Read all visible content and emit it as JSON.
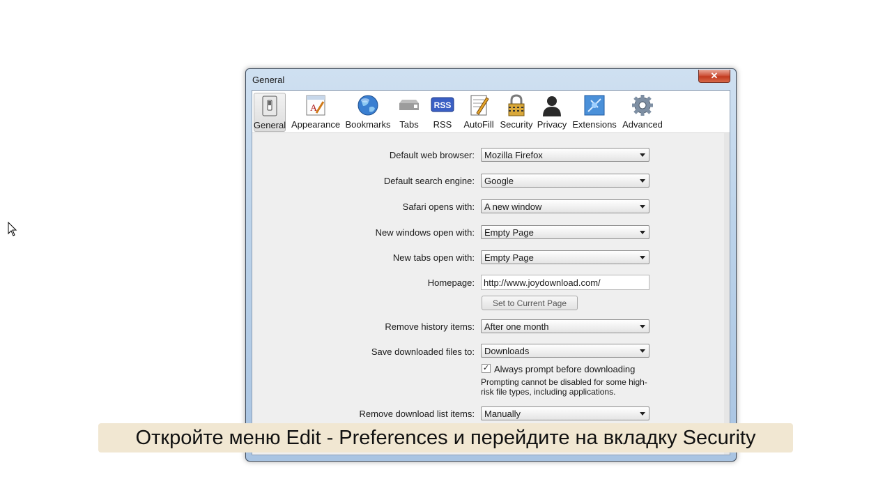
{
  "window": {
    "title": "General",
    "close_glyph": "✕"
  },
  "toolbar": {
    "items": [
      {
        "label": "General",
        "icon": "general-switch-icon",
        "active": true
      },
      {
        "label": "Appearance",
        "icon": "appearance-icon"
      },
      {
        "label": "Bookmarks",
        "icon": "globe-icon"
      },
      {
        "label": "Tabs",
        "icon": "tabs-icon"
      },
      {
        "label": "RSS",
        "icon": "rss-icon"
      },
      {
        "label": "AutoFill",
        "icon": "autofill-icon"
      },
      {
        "label": "Security",
        "icon": "lock-icon"
      },
      {
        "label": "Privacy",
        "icon": "person-silhouette-icon"
      },
      {
        "label": "Extensions",
        "icon": "extensions-icon"
      },
      {
        "label": "Advanced",
        "icon": "gear-icon"
      }
    ]
  },
  "form": {
    "default_browser": {
      "label": "Default web browser:",
      "value": "Mozilla Firefox"
    },
    "search_engine": {
      "label": "Default search engine:",
      "value": "Google"
    },
    "safari_opens": {
      "label": "Safari opens with:",
      "value": "A new window"
    },
    "new_windows": {
      "label": "New windows open with:",
      "value": "Empty Page"
    },
    "new_tabs": {
      "label": "New tabs open with:",
      "value": "Empty Page"
    },
    "homepage": {
      "label": "Homepage:",
      "value": "http://www.joydownload.com/",
      "button": "Set to Current Page"
    },
    "remove_history": {
      "label": "Remove history items:",
      "value": "After one month"
    },
    "save_downloads": {
      "label": "Save downloaded files to:",
      "value": "Downloads"
    },
    "always_prompt": {
      "label": "Always prompt before downloading",
      "checked": true,
      "note": "Prompting cannot be disabled for some high-risk file types, including applications."
    },
    "remove_download_list": {
      "label": "Remove download list items:",
      "value": "Manually"
    }
  },
  "caption": {
    "text": "Откройте меню Edit - Preferences и перейдите на вкладку Security"
  },
  "colors": {
    "frame": "#bcd3ea",
    "close": "#c23a1f",
    "caption_bg": "#f1e7d2"
  }
}
